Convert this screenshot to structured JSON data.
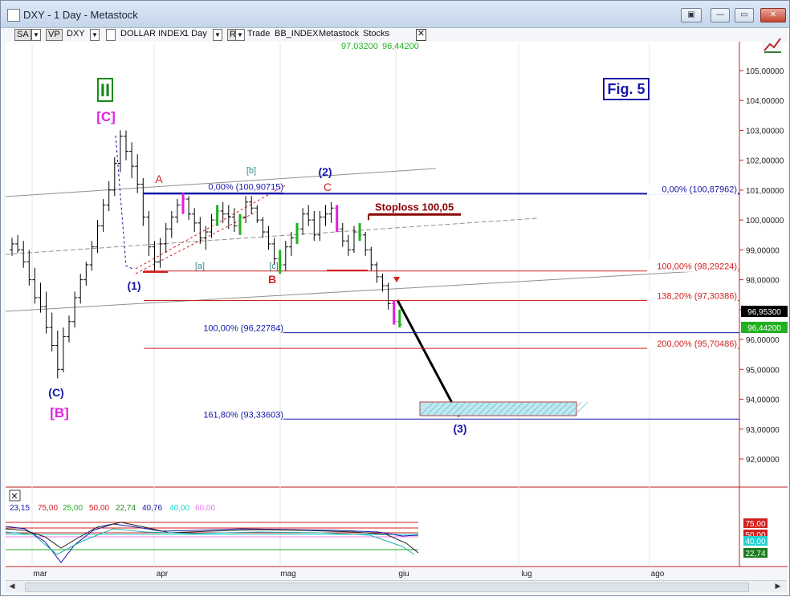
{
  "window": {
    "title": "DXY - 1 Day - Metastock",
    "buttons": [
      "▣",
      "—",
      "▭",
      "✕"
    ]
  },
  "toolbar": {
    "sa": "SA",
    "vp": "VP",
    "symbol": "DXY",
    "dropdown_glyph": "▼",
    "name": "DOLLAR INDEX",
    "period": "1 Day",
    "r": "R",
    "trade": "Trade",
    "bb_index": "BB_INDEX",
    "metastock": "Metastock",
    "stocks": "Stocks",
    "close_glyph": "✕",
    "hi": "97,03200",
    "lo": "96,44200"
  },
  "colors": {
    "red": "#d42020",
    "navy": "#1616a8",
    "magenta": "#e020e0",
    "green": "#22b022",
    "teal": "#3a8a8a",
    "darkred": "#8a0000"
  },
  "chart_data": {
    "type": "candlestick",
    "title": "Fig. 5",
    "y_ticks": [
      "105,00000",
      "104,00000",
      "103,00000",
      "102,00000",
      "101,00000",
      "100,00000",
      "99,00000",
      "98,00000",
      "97,00000",
      "96,00000",
      "95,00000",
      "94,00000",
      "93,00000",
      "92,00000"
    ],
    "y_tick_values": [
      105,
      104,
      103,
      102,
      101,
      100,
      99,
      98,
      97,
      96,
      95,
      94,
      93,
      92
    ],
    "ylim": [
      91.1,
      105.7
    ],
    "x_ticks": [
      "mar",
      "apr",
      "mag",
      "giu",
      "lug",
      "ago"
    ],
    "last_price": "96,95300",
    "last_close": "96,44200",
    "bars": [
      [
        99.0,
        99.4,
        98.8,
        99.2
      ],
      [
        99.2,
        99.5,
        98.9,
        99.0
      ],
      [
        99.0,
        99.3,
        98.4,
        98.6
      ],
      [
        98.6,
        99.0,
        97.8,
        98.0
      ],
      [
        98.0,
        98.4,
        97.2,
        97.4
      ],
      [
        97.4,
        97.9,
        96.9,
        97.1
      ],
      [
        97.1,
        97.6,
        96.2,
        96.4
      ],
      [
        96.4,
        96.9,
        95.6,
        95.8
      ],
      [
        95.8,
        96.3,
        94.7,
        95.0
      ],
      [
        95.0,
        96.4,
        94.9,
        96.1
      ],
      [
        96.1,
        96.8,
        95.9,
        96.6
      ],
      [
        96.6,
        97.6,
        96.4,
        97.4
      ],
      [
        97.4,
        98.2,
        97.2,
        98.0
      ],
      [
        98.0,
        98.6,
        97.8,
        98.5
      ],
      [
        98.5,
        99.3,
        98.3,
        99.1
      ],
      [
        99.1,
        100.0,
        98.9,
        99.8
      ],
      [
        99.8,
        100.7,
        99.6,
        100.5
      ],
      [
        100.5,
        101.3,
        100.3,
        101.0
      ],
      [
        101.0,
        102.1,
        100.8,
        101.9
      ],
      [
        101.9,
        103.0,
        101.6,
        102.8
      ],
      [
        102.8,
        103.0,
        102.0,
        102.3
      ],
      [
        102.3,
        102.6,
        101.4,
        101.8
      ],
      [
        101.8,
        102.2,
        100.9,
        101.2
      ],
      [
        101.2,
        101.4,
        99.8,
        100.1
      ],
      [
        100.1,
        100.3,
        98.8,
        99.1
      ],
      [
        99.1,
        99.3,
        98.3,
        98.6
      ],
      [
        98.6,
        99.4,
        98.4,
        99.2
      ],
      [
        99.2,
        99.9,
        98.9,
        99.7
      ],
      [
        99.7,
        100.3,
        99.4,
        100.1
      ],
      [
        100.1,
        100.7,
        99.9,
        100.5
      ],
      [
        100.5,
        100.9,
        100.2,
        100.7
      ],
      [
        100.7,
        100.8,
        100.0,
        100.2
      ],
      [
        100.2,
        100.4,
        99.6,
        99.9
      ],
      [
        99.9,
        100.1,
        99.2,
        99.4
      ],
      [
        99.4,
        99.8,
        99.0,
        99.6
      ],
      [
        99.6,
        100.2,
        99.4,
        100.0
      ],
      [
        100.0,
        100.5,
        99.8,
        100.3
      ],
      [
        100.3,
        100.6,
        99.9,
        100.2
      ],
      [
        100.2,
        100.5,
        99.7,
        100.1
      ],
      [
        100.1,
        100.4,
        99.6,
        99.8
      ],
      [
        99.8,
        100.2,
        99.5,
        100.1
      ],
      [
        100.1,
        100.8,
        99.9,
        100.6
      ],
      [
        100.6,
        100.8,
        100.2,
        100.4
      ],
      [
        100.4,
        100.5,
        99.9,
        100.0
      ],
      [
        100.0,
        100.1,
        99.4,
        99.6
      ],
      [
        99.6,
        99.8,
        99.0,
        99.2
      ],
      [
        99.2,
        99.4,
        98.5,
        98.7
      ],
      [
        98.7,
        99.0,
        98.2,
        98.5
      ],
      [
        98.5,
        99.3,
        98.3,
        99.1
      ],
      [
        99.1,
        99.6,
        98.8,
        99.4
      ],
      [
        99.4,
        99.9,
        99.2,
        99.7
      ],
      [
        99.7,
        100.4,
        99.5,
        100.2
      ],
      [
        100.2,
        100.5,
        99.8,
        100.0
      ],
      [
        100.0,
        100.3,
        99.3,
        99.5
      ],
      [
        99.5,
        100.3,
        99.3,
        100.1
      ],
      [
        100.1,
        100.5,
        99.8,
        100.2
      ],
      [
        100.2,
        100.6,
        99.9,
        100.4
      ],
      [
        100.4,
        100.5,
        99.6,
        99.7
      ],
      [
        99.7,
        99.9,
        99.1,
        99.3
      ],
      [
        99.3,
        99.5,
        98.8,
        99.0
      ],
      [
        99.0,
        99.8,
        98.9,
        99.6
      ],
      [
        99.6,
        99.9,
        99.3,
        99.5
      ],
      [
        99.5,
        99.6,
        98.8,
        99.0
      ],
      [
        99.0,
        99.1,
        98.3,
        98.5
      ],
      [
        98.5,
        98.6,
        97.9,
        98.1
      ],
      [
        98.1,
        98.2,
        97.6,
        97.8
      ],
      [
        97.8,
        97.9,
        97.0,
        97.2
      ],
      [
        97.2,
        97.3,
        96.5,
        96.6
      ],
      [
        96.6,
        97.0,
        96.4,
        96.5
      ]
    ],
    "colored_bars": [
      {
        "i": 30,
        "color": "#e020e0"
      },
      {
        "i": 36,
        "color": "#22b022"
      },
      {
        "i": 40,
        "color": "#22b022"
      },
      {
        "i": 47,
        "color": "#22b022"
      },
      {
        "i": 50,
        "color": "#22b022"
      },
      {
        "i": 57,
        "color": "#e020e0"
      },
      {
        "i": 61,
        "color": "#22b022"
      },
      {
        "i": 67,
        "color": "#e020e0"
      },
      {
        "i": 68,
        "color": "#22b022"
      }
    ],
    "fib_levels": [
      {
        "label": "0,00% (100,87962)",
        "value": 100.87962,
        "color": "#1616a8"
      },
      {
        "label": "100,00% (98,29224)",
        "value": 98.29224,
        "color": "#d42020"
      },
      {
        "label": "138,20% (97,30386)",
        "value": 97.30386,
        "color": "#d42020"
      },
      {
        "label": "200,00% (95,70486)",
        "value": 95.70486,
        "color": "#d42020"
      },
      {
        "label": "0,00% (100,90715)",
        "value": 100.90715,
        "color": "#1616a8"
      },
      {
        "label": "100,00% (96,22784)",
        "value": 96.22784,
        "color": "#1616a8"
      },
      {
        "label": "161,80% (93,33603)",
        "value": 93.33603,
        "color": "#1616a8"
      }
    ],
    "stoploss": {
      "label": "Stoploss 100,05",
      "value": 100.05
    },
    "wave_labels": [
      "II",
      "[C]",
      "(C)",
      "[B]",
      "A",
      "[b]",
      "(2)",
      "C",
      "(1)",
      "[a]",
      "[c]",
      "B",
      "(3)"
    ],
    "indicator": {
      "values": [
        "23,15",
        "75,00",
        "25,00",
        "50,00",
        "22,74",
        "40,76",
        "40,00",
        "60,00"
      ],
      "value_colors": [
        "#1616a8",
        "#d42020",
        "#22b022",
        "#d42020",
        "#228822",
        "#1616a8",
        "#22d0d0",
        "#e878e8"
      ],
      "right_tags": [
        "75,00",
        "50,00",
        "40,00",
        "22,74"
      ],
      "right_tag_colors": [
        "#d42020",
        "#d42020",
        "#22d0d0",
        "#1a7a1a"
      ]
    }
  }
}
